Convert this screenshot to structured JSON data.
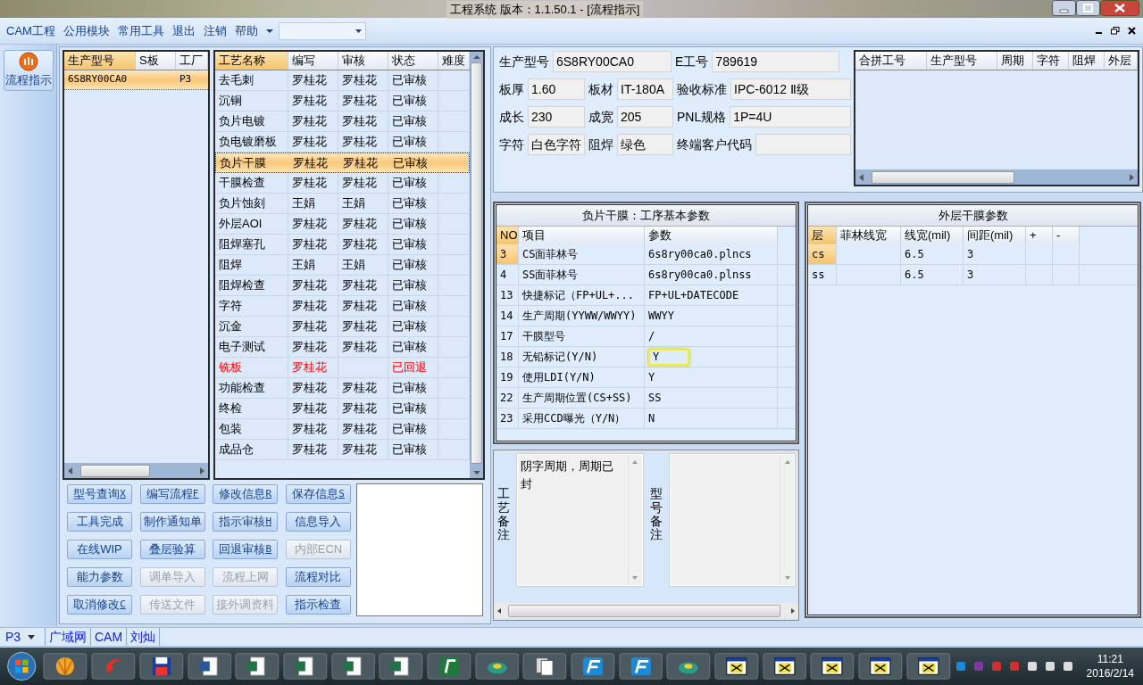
{
  "window": {
    "title": "工程系统   版本：1.1.50.1 - [流程指示]"
  },
  "menu": [
    "CAM工程",
    "公用模块",
    "常用工具",
    "退出",
    "注销",
    "帮助"
  ],
  "nav": [
    {
      "label": "流程指示",
      "selected": true
    }
  ],
  "models": {
    "columns": [
      {
        "label": "生产型号",
        "sorted": true
      },
      {
        "label": "S板",
        "sorted": false
      },
      {
        "label": "工厂",
        "sorted": false
      }
    ],
    "rows": [
      {
        "cells": [
          "6S8RY00CA0",
          "",
          "P3"
        ],
        "selected": true
      }
    ]
  },
  "process": {
    "columns": [
      {
        "label": "工艺名称",
        "sorted": true
      },
      {
        "label": "编写",
        "sorted": false
      },
      {
        "label": "审核",
        "sorted": false
      },
      {
        "label": "状态",
        "sorted": false
      },
      {
        "label": "难度",
        "sorted": false
      }
    ],
    "rows": [
      {
        "cells": [
          "去毛刺",
          "罗桂花",
          "罗桂花",
          "已审核"
        ],
        "selected": false,
        "kind": "normal"
      },
      {
        "cells": [
          "沉铜",
          "罗桂花",
          "罗桂花",
          "已审核"
        ],
        "selected": false,
        "kind": "normal"
      },
      {
        "cells": [
          "负片电镀",
          "罗桂花",
          "罗桂花",
          "已审核"
        ],
        "selected": false,
        "kind": "normal"
      },
      {
        "cells": [
          "负电镀磨板",
          "罗桂花",
          "罗桂花",
          "已审核"
        ],
        "selected": false,
        "kind": "normal"
      },
      {
        "cells": [
          "负片干膜",
          "罗桂花",
          "罗桂花",
          "已审核"
        ],
        "selected": true,
        "kind": "normal"
      },
      {
        "cells": [
          "干膜检查",
          "罗桂花",
          "罗桂花",
          "已审核"
        ],
        "selected": false,
        "kind": "normal"
      },
      {
        "cells": [
          "负片蚀刻",
          "王娟",
          "王娟",
          "已审核"
        ],
        "selected": false,
        "kind": "normal"
      },
      {
        "cells": [
          "外层AOI",
          "罗桂花",
          "罗桂花",
          "已审核"
        ],
        "selected": false,
        "kind": "normal"
      },
      {
        "cells": [
          "阻焊塞孔",
          "罗桂花",
          "罗桂花",
          "已审核"
        ],
        "selected": false,
        "kind": "normal"
      },
      {
        "cells": [
          "阻焊",
          "王娟",
          "王娟",
          "已审核"
        ],
        "selected": false,
        "kind": "normal"
      },
      {
        "cells": [
          "阻焊检查",
          "罗桂花",
          "罗桂花",
          "已审核"
        ],
        "selected": false,
        "kind": "normal"
      },
      {
        "cells": [
          "字符",
          "罗桂花",
          "罗桂花",
          "已审核"
        ],
        "selected": false,
        "kind": "normal"
      },
      {
        "cells": [
          "沉金",
          "罗桂花",
          "罗桂花",
          "已审核"
        ],
        "selected": false,
        "kind": "normal"
      },
      {
        "cells": [
          "电子测试",
          "罗桂花",
          "罗桂花",
          "已审核"
        ],
        "selected": false,
        "kind": "normal"
      },
      {
        "cells": [
          "铣板",
          "罗桂花",
          "",
          "已回退"
        ],
        "selected": false,
        "kind": "returned"
      },
      {
        "cells": [
          "功能检查",
          "罗桂花",
          "罗桂花",
          "已审核"
        ],
        "selected": false,
        "kind": "normal"
      },
      {
        "cells": [
          "终检",
          "罗桂花",
          "罗桂花",
          "已审核"
        ],
        "selected": false,
        "kind": "normal"
      },
      {
        "cells": [
          "包装",
          "罗桂花",
          "罗桂花",
          "已审核"
        ],
        "selected": false,
        "kind": "normal"
      },
      {
        "cells": [
          "成品仓",
          "罗桂花",
          "罗桂花",
          "已审核"
        ],
        "selected": false,
        "kind": "normal"
      }
    ]
  },
  "buttons": [
    {
      "label": "型号查询",
      "shortcut": "X",
      "disabled": false
    },
    {
      "label": "编写流程",
      "shortcut": "F",
      "disabled": false
    },
    {
      "label": "修改信息",
      "shortcut": "R",
      "disabled": false
    },
    {
      "label": "保存信息",
      "shortcut": "S",
      "disabled": false
    },
    {
      "label": "工具完成",
      "disabled": false
    },
    {
      "label": "制作通知单",
      "disabled": false
    },
    {
      "label": "指示审核",
      "shortcut": "H",
      "disabled": false
    },
    {
      "label": "信息导入",
      "disabled": false
    },
    {
      "label": "在线WIP",
      "disabled": false
    },
    {
      "label": "叠层验算",
      "disabled": false
    },
    {
      "label": "回退审核",
      "shortcut": "B",
      "disabled": false
    },
    {
      "label": "内部ECN",
      "disabled": true
    },
    {
      "label": "能力参数",
      "disabled": false
    },
    {
      "label": "调单导入",
      "disabled": true
    },
    {
      "label": "流程上网",
      "disabled": true
    },
    {
      "label": "流程对比",
      "disabled": false
    },
    {
      "label": "取消修改",
      "shortcut": "C",
      "disabled": false
    },
    {
      "label": "传送文件",
      "disabled": true
    },
    {
      "label": "接外调资料",
      "disabled": true
    },
    {
      "label": "指示检查",
      "disabled": false
    }
  ],
  "info": [
    [
      {
        "label": "生产型号",
        "value": "6S8RY00CA0"
      },
      {
        "label": "E工号",
        "value": "789619"
      }
    ],
    [
      {
        "label": "板厚",
        "value": "1.60"
      },
      {
        "label": "板材",
        "value": "IT-180A"
      },
      {
        "label": "验收标准",
        "value": "IPC-6012 Ⅱ级"
      }
    ],
    [
      {
        "label": "成长",
        "value": "230"
      },
      {
        "label": "成宽",
        "value": "205"
      },
      {
        "label": "PNL规格",
        "value": "1P=4U"
      }
    ],
    [
      {
        "label": "字符",
        "value": "白色字符"
      },
      {
        "label": "阻焊",
        "value": "绿色"
      },
      {
        "label": "终端客户代码"
      }
    ]
  ],
  "merged_table": {
    "columns": [
      "合拼工号",
      "生产型号",
      "周期",
      "字符",
      "阻焊",
      "外层"
    ]
  },
  "process_params": {
    "title": "负片干膜：工序基本参数",
    "columns": [
      "NO",
      "项目",
      "参数"
    ],
    "rows": [
      {
        "cells": [
          "3",
          "CS面菲林号",
          "6s8ry00ca0.plncs"
        ],
        "selected": true,
        "highlighted": false
      },
      {
        "cells": [
          "4",
          "SS面菲林号",
          "6s8ry00ca0.plnss"
        ],
        "selected": false,
        "highlighted": false
      },
      {
        "cells": [
          "13",
          "快捷标记（FP+UL+...",
          "FP+UL+DATECODE"
        ],
        "selected": false,
        "highlighted": false
      },
      {
        "cells": [
          "14",
          "生产周期(YYWW/WWYY)",
          "WWYY"
        ],
        "selected": false,
        "highlighted": false
      },
      {
        "cells": [
          "17",
          "干膜型号",
          "/"
        ],
        "selected": false,
        "highlighted": false
      },
      {
        "cells": [
          "18",
          "无铅标记(Y/N)",
          "Y"
        ],
        "selected": false,
        "highlighted": true
      },
      {
        "cells": [
          "19",
          "使用LDI(Y/N)",
          "Y"
        ],
        "selected": false,
        "highlighted": false
      },
      {
        "cells": [
          "22",
          "生产周期位置(CS+SS)",
          "SS"
        ],
        "selected": false,
        "highlighted": false
      },
      {
        "cells": [
          "23",
          "采用CCD曝光（Y/N）",
          "N"
        ],
        "selected": false,
        "highlighted": false
      }
    ]
  },
  "outer_params": {
    "title": "外层干膜参数",
    "columns": [
      "层",
      "菲林线宽",
      "线宽(mil)",
      "间距(mil)",
      "+",
      "-"
    ],
    "rows": [
      {
        "cells": [
          "cs",
          "",
          "6.5",
          "3",
          "",
          ""
        ],
        "selected": true
      },
      {
        "cells": [
          "ss",
          "",
          "6.5",
          "3",
          "",
          ""
        ],
        "selected": false
      }
    ]
  },
  "remarks": [
    {
      "label": "工艺备注",
      "text": "阴字周期，周期已封"
    },
    {
      "label": "型号备注"
    }
  ],
  "status_bar": {
    "factory": "P3",
    "items": [
      "广域网",
      "CAM",
      "刘灿"
    ]
  },
  "clock": {
    "time": "11:21",
    "date": "2016/2/14"
  }
}
